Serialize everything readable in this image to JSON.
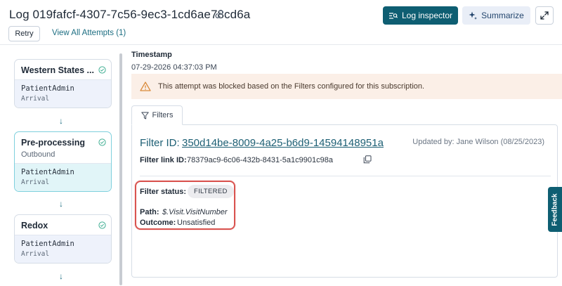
{
  "header": {
    "title": "Log 019fafcf-4307-7c56-9ec3-1cd6ae78cd6a",
    "retry_label": "Retry",
    "view_all_label": "View All Attempts (1)",
    "log_inspector_label": "Log inspector",
    "summarize_label": "Summarize"
  },
  "flow": {
    "steps": [
      {
        "title": "Western States ...",
        "subtitle": "",
        "user": "PatientAdmin",
        "event": "Arrival"
      },
      {
        "title": "Pre-processing",
        "subtitle": "Outbound",
        "user": "PatientAdmin",
        "event": "Arrival"
      },
      {
        "title": "Redox",
        "subtitle": "",
        "user": "PatientAdmin",
        "event": "Arrival"
      }
    ],
    "arrow": "↓"
  },
  "detail": {
    "timestamp_label": "Timestamp",
    "timestamp_value": "07-29-2026 04:37:03 PM",
    "alert_text": "This attempt was blocked based on the Filters configured for this subscription.",
    "tab_label": "Filters",
    "filter_id_label": "Filter ID:",
    "filter_id_value": "350d14be-8009-4a25-b6d9-14594148951a",
    "updated_by": "Updated by: Jane Wilson (08/25/2023)",
    "filter_link_label": "Filter link ID:",
    "filter_link_value": "78379ac9-6c06-432b-8431-5a1c9901c98a",
    "filter_status_label": "Filter status:",
    "filter_status_value": "FILTERED",
    "path_label": "Path:",
    "path_value": "$.Visit.VisitNumber",
    "outcome_label": "Outcome:",
    "outcome_value": "Unsatisfied"
  },
  "feedback_label": "Feedback",
  "colors": {
    "primary": "#0e5e72",
    "link": "#1d6e82",
    "alert_bg": "#fbefe7",
    "highlight": "#d9534f",
    "check": "#3fae92"
  },
  "icons": [
    "link-icon",
    "log-inspector-icon",
    "sparkle-icon",
    "expand-icon",
    "check-circle-icon",
    "warning-icon",
    "filter-icon",
    "copy-icon"
  ]
}
